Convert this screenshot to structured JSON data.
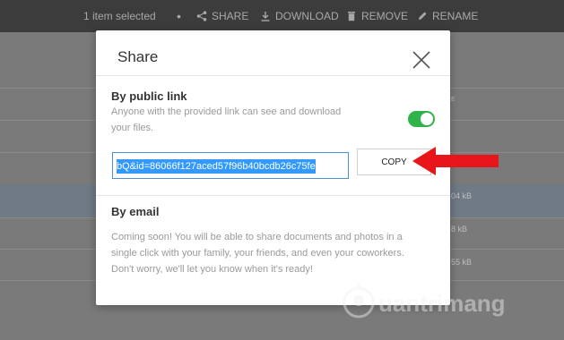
{
  "toolbar": {
    "selection": "1 item selected",
    "separator": "•",
    "share": "SHARE",
    "download": "DOWNLOAD",
    "remove": "REMOVE",
    "rename": "RENAME"
  },
  "file_list": {
    "header_partial": "E",
    "sizes": [
      "04 kB",
      "8 kB",
      "55 kB"
    ]
  },
  "modal": {
    "title": "Share",
    "public_link": {
      "title": "By public link",
      "description_line1": "Anyone with the provided link can see and download",
      "description_line2": "your files.",
      "toggle_enabled": true,
      "link_value": "bQ&id=86066f127aced57f96b40bcdb26c75fe",
      "copy_label": "COPY"
    },
    "email": {
      "title": "By email",
      "line1": "Coming soon! You will be able to share documents and photos in a",
      "line2": "single click with your family, your friends, and even your coworkers.",
      "line3": "Don't worry, we'll let you know when it's ready!"
    }
  },
  "colors": {
    "toggle_on": "#2fb34a",
    "annotation_arrow": "#e8161b",
    "selection_highlight": "#3399ff"
  },
  "watermark": "uantrimang"
}
